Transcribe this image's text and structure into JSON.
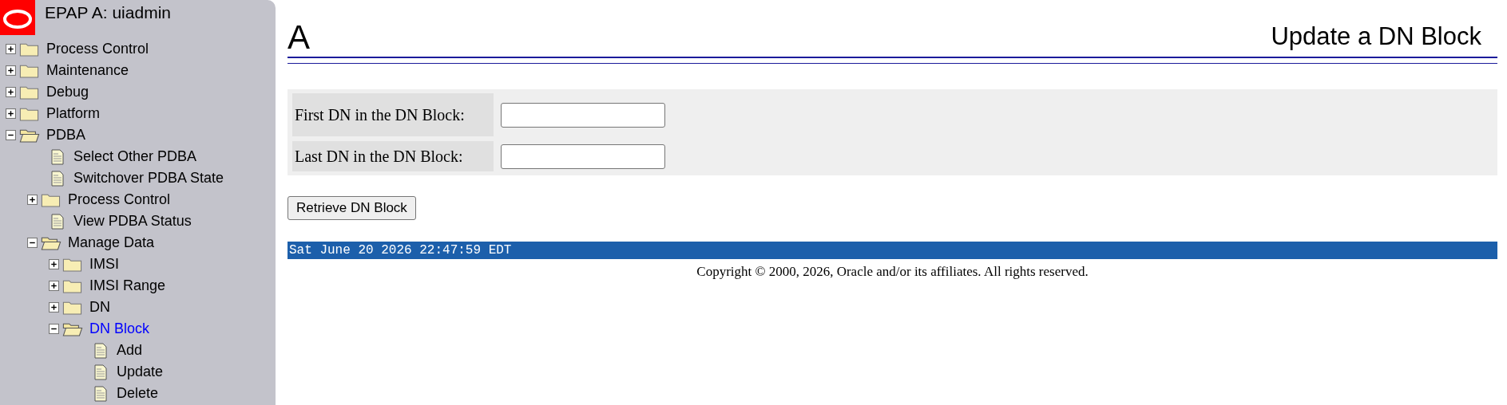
{
  "sidebar": {
    "title": "EPAP A: uiadmin",
    "tree": [
      {
        "kind": "folder",
        "label": "Process Control",
        "expanded": false,
        "selected": false
      },
      {
        "kind": "folder",
        "label": "Maintenance",
        "expanded": false,
        "selected": false
      },
      {
        "kind": "folder",
        "label": "Debug",
        "expanded": false,
        "selected": false
      },
      {
        "kind": "folder",
        "label": "Platform",
        "expanded": false,
        "selected": false
      },
      {
        "kind": "folder",
        "label": "PDBA",
        "expanded": true,
        "selected": false,
        "children": [
          {
            "kind": "page",
            "label": "Select Other PDBA",
            "selected": false
          },
          {
            "kind": "page",
            "label": "Switchover PDBA State",
            "selected": false
          },
          {
            "kind": "folder",
            "label": "Process Control",
            "expanded": false,
            "selected": false
          },
          {
            "kind": "page",
            "label": "View PDBA Status",
            "selected": false
          },
          {
            "kind": "folder",
            "label": "Manage Data",
            "expanded": true,
            "selected": false,
            "children": [
              {
                "kind": "folder",
                "label": "IMSI",
                "expanded": false,
                "selected": false
              },
              {
                "kind": "folder",
                "label": "IMSI Range",
                "expanded": false,
                "selected": false
              },
              {
                "kind": "folder",
                "label": "DN",
                "expanded": false,
                "selected": false
              },
              {
                "kind": "folder",
                "label": "DN Block",
                "expanded": true,
                "selected": true,
                "children": [
                  {
                    "kind": "page",
                    "label": "Add",
                    "selected": false
                  },
                  {
                    "kind": "page",
                    "label": "Update",
                    "selected": false
                  },
                  {
                    "kind": "page",
                    "label": "Delete",
                    "selected": false
                  }
                ]
              }
            ]
          }
        ]
      }
    ]
  },
  "header": {
    "system": "A",
    "title": "Update a DN Block"
  },
  "form": {
    "fields": [
      {
        "label": "First DN in the DN Block:"
      },
      {
        "label": "Last DN in the DN Block:"
      }
    ],
    "button": "Retrieve DN Block"
  },
  "status_bar": {
    "datetime": "Sat June 20 2026 22:47:59 EDT"
  },
  "footer": {
    "copyright": "Copyright © 2000, 2026, Oracle and/or its affiliates. All rights reserved."
  }
}
